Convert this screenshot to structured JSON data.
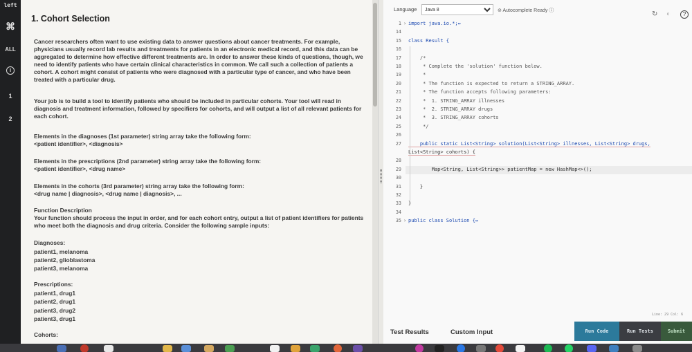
{
  "rail": {
    "top_label": "left",
    "cmd_glyph": "⌘",
    "all_label": "ALL",
    "info_glyph": "i",
    "item1": "1",
    "item2": "2"
  },
  "problem": {
    "title": "1. Cohort Selection",
    "paragraphs": [
      "Cancer researchers often want to use existing data to answer questions about cancer treatments. For example, physicians usually record lab results and treatments for patients in an electronic medical record, and this data can be aggregated to determine how effective different treatments are. In order to answer these kinds of questions, though, we need to identify patients who have certain clinical characteristics in common. We call such a collection of patients a cohort. A cohort might consist of patients who were diagnosed with a particular type of cancer, and who have been treated with a particular drug.",
      "Your job is to build a tool to identify patients who should be included in particular cohorts. Your tool will read in diagnosis and treatment information, followed by specifiers for cohorts, and will output a list of all relevant patients for each cohort.",
      "Elements in the diagnoses (1st parameter) string array take the following form:",
      "<patient identifier>, <diagnosis>",
      "Elements in the prescriptions (2nd parameter) string array take the following form:",
      "<patient identifier>, <drug name>",
      "Elements in the cohorts (3rd parameter) string array take the following form:",
      "<drug name | diagnosis>, <drug name | diagnosis>, ...",
      "Function Description",
      "Your function should process the input in order, and for each cohort entry, output a list of patient identifiers for patients who meet both the diagnosis and drug criteria. Consider the following sample inputs:",
      "Diagnoses:",
      "patient1, melanoma",
      "patient2, glioblastoma",
      "patient3, melanoma",
      "Prescriptions:",
      "patient1, drug1",
      "patient2, drug1",
      "patient3, drug2",
      "patient3, drug1",
      "Cohorts:"
    ]
  },
  "editor": {
    "language_label": "Language",
    "language_value": "Java 8",
    "autocomplete": "Autocomplete Ready",
    "code": [
      {
        "n": "1",
        "t": "import java.io.*;↔",
        "fold": "›"
      },
      {
        "n": "14",
        "t": ""
      },
      {
        "n": "15",
        "t": "class Result {"
      },
      {
        "n": "16",
        "t": ""
      },
      {
        "n": "17",
        "t": "    /*"
      },
      {
        "n": "18",
        "t": "     * Complete the 'solution' function below."
      },
      {
        "n": "19",
        "t": "     *"
      },
      {
        "n": "20",
        "t": "     * The function is expected to return a STRING_ARRAY."
      },
      {
        "n": "21",
        "t": "     * The function accepts following parameters:"
      },
      {
        "n": "22",
        "t": "     *  1. STRING_ARRAY illnesses"
      },
      {
        "n": "23",
        "t": "     *  2. STRING_ARRAY drugs"
      },
      {
        "n": "24",
        "t": "     *  3. STRING_ARRAY cohorts"
      },
      {
        "n": "25",
        "t": "     */"
      },
      {
        "n": "26",
        "t": ""
      },
      {
        "n": "27",
        "t": "    public static List<String> solution(List<String> illnesses, List<String> drugs,"
      },
      {
        "n": "",
        "t": "List<String> cohorts) {"
      },
      {
        "n": "28",
        "t": ""
      },
      {
        "n": "29",
        "t": "        Map<String, List<String>> patientMap = new HashMap<>();"
      },
      {
        "n": "30",
        "t": ""
      },
      {
        "n": "31",
        "t": "    }"
      },
      {
        "n": "32",
        "t": ""
      },
      {
        "n": "33",
        "t": "}"
      },
      {
        "n": "34",
        "t": ""
      },
      {
        "n": "35",
        "t": "public class Solution {↔",
        "fold": "›"
      }
    ],
    "line_col": "Line: 29 Col: 6",
    "tab_test_results": "Test Results",
    "tab_custom_input": "Custom Input",
    "run_code": "Run Code",
    "run_tests": "Run Tests",
    "submit": "Submit"
  }
}
